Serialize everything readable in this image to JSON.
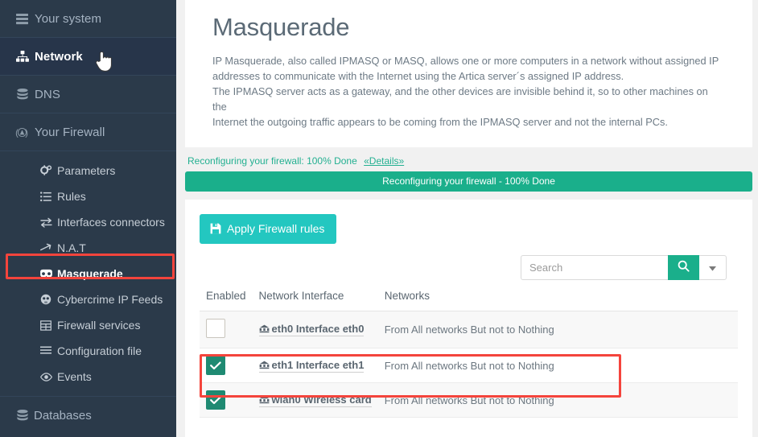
{
  "sidebar": {
    "top_items": [
      {
        "label": "Your system",
        "icon": "server-icon",
        "active": false
      },
      {
        "label": "Network",
        "icon": "sitemap-icon",
        "active": true
      },
      {
        "label": "DNS",
        "icon": "database-icon",
        "active": false
      },
      {
        "label": "Your Firewall",
        "icon": "shield-circle-icon",
        "active": false
      }
    ],
    "sub_items": [
      {
        "label": "Parameters",
        "icon": "cogs-icon",
        "highlight": false
      },
      {
        "label": "Rules",
        "icon": "list-icon",
        "highlight": false
      },
      {
        "label": "Interfaces connectors",
        "icon": "exchange-icon",
        "highlight": false
      },
      {
        "label": "N.A.T",
        "icon": "arrow-right-icon",
        "highlight": false
      },
      {
        "label": "Masquerade",
        "icon": "mask-icon",
        "highlight": true
      },
      {
        "label": "Cybercrime IP Feeds",
        "icon": "skull-icon",
        "highlight": false
      },
      {
        "label": "Firewall services",
        "icon": "table-icon",
        "highlight": false
      },
      {
        "label": "Configuration file",
        "icon": "bars-icon",
        "highlight": false
      },
      {
        "label": "Events",
        "icon": "eye-icon",
        "highlight": false
      }
    ],
    "bottom_items": [
      {
        "label": "Databases",
        "icon": "database-icon"
      }
    ]
  },
  "main": {
    "title": "Masquerade",
    "description_lines": [
      "IP Masquerade, also called IPMASQ or MASQ, allows one or more computers in a network without assigned IP",
      "addresses to communicate with the Internet using the Artica server´s assigned IP address.",
      "The IPMASQ server acts as a gateway, and the other devices are invisible behind it, so to other machines on the",
      "Internet the outgoing traffic appears to be coming from the IPMASQ server and not the internal PCs."
    ],
    "status": {
      "text": "Reconfiguring your firewall: 100% Done",
      "details_link": "«Details»",
      "progress_label": "Reconfiguring your firewall - 100% Done",
      "progress_percent": 100,
      "color": "#1aaf8b"
    },
    "apply_button": {
      "label": "Apply Firewall rules",
      "icon": "save-icon",
      "color": "#23c7c0"
    },
    "search": {
      "placeholder": "Search",
      "value": "",
      "button_icon": "search-icon",
      "caret_icon": "caret-down-icon"
    },
    "table": {
      "columns": [
        "Enabled",
        "Network Interface",
        "Networks"
      ],
      "rows": [
        {
          "enabled": false,
          "interface": "eth0 Interface eth0",
          "interface_icon": "network-wired-icon",
          "networks": "From All networks But not to Nothing"
        },
        {
          "enabled": true,
          "interface": "eth1 Interface eth1",
          "interface_icon": "network-wired-icon",
          "networks": "From All networks But not to Nothing"
        },
        {
          "enabled": true,
          "interface": "wlan0 Wireless card",
          "interface_icon": "network-wired-icon",
          "networks": "From All networks But not to Nothing"
        }
      ]
    }
  },
  "annotations": {
    "highlight_color": "#f4443c",
    "sidebar_highlight_target": "Masquerade",
    "table_highlight_target": "wlan0 Wireless card"
  }
}
